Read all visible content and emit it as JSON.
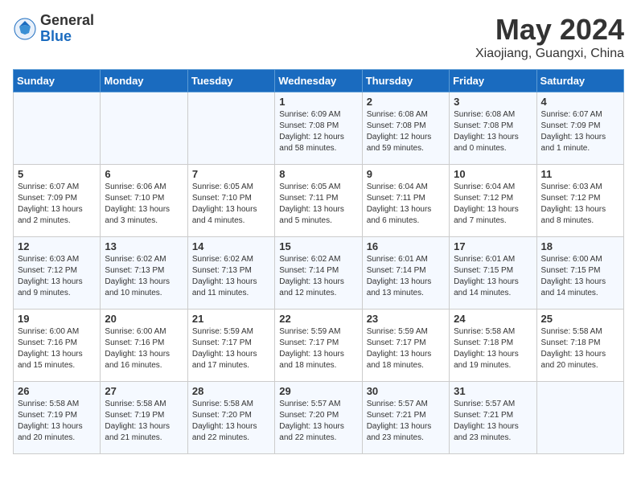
{
  "header": {
    "logo_general": "General",
    "logo_blue": "Blue",
    "month_title": "May 2024",
    "location": "Xiaojiang, Guangxi, China"
  },
  "weekdays": [
    "Sunday",
    "Monday",
    "Tuesday",
    "Wednesday",
    "Thursday",
    "Friday",
    "Saturday"
  ],
  "weeks": [
    [
      {
        "day": "",
        "info": ""
      },
      {
        "day": "",
        "info": ""
      },
      {
        "day": "",
        "info": ""
      },
      {
        "day": "1",
        "info": "Sunrise: 6:09 AM\nSunset: 7:08 PM\nDaylight: 12 hours and 58 minutes."
      },
      {
        "day": "2",
        "info": "Sunrise: 6:08 AM\nSunset: 7:08 PM\nDaylight: 12 hours and 59 minutes."
      },
      {
        "day": "3",
        "info": "Sunrise: 6:08 AM\nSunset: 7:08 PM\nDaylight: 13 hours and 0 minutes."
      },
      {
        "day": "4",
        "info": "Sunrise: 6:07 AM\nSunset: 7:09 PM\nDaylight: 13 hours and 1 minute."
      }
    ],
    [
      {
        "day": "5",
        "info": "Sunrise: 6:07 AM\nSunset: 7:09 PM\nDaylight: 13 hours and 2 minutes."
      },
      {
        "day": "6",
        "info": "Sunrise: 6:06 AM\nSunset: 7:10 PM\nDaylight: 13 hours and 3 minutes."
      },
      {
        "day": "7",
        "info": "Sunrise: 6:05 AM\nSunset: 7:10 PM\nDaylight: 13 hours and 4 minutes."
      },
      {
        "day": "8",
        "info": "Sunrise: 6:05 AM\nSunset: 7:11 PM\nDaylight: 13 hours and 5 minutes."
      },
      {
        "day": "9",
        "info": "Sunrise: 6:04 AM\nSunset: 7:11 PM\nDaylight: 13 hours and 6 minutes."
      },
      {
        "day": "10",
        "info": "Sunrise: 6:04 AM\nSunset: 7:12 PM\nDaylight: 13 hours and 7 minutes."
      },
      {
        "day": "11",
        "info": "Sunrise: 6:03 AM\nSunset: 7:12 PM\nDaylight: 13 hours and 8 minutes."
      }
    ],
    [
      {
        "day": "12",
        "info": "Sunrise: 6:03 AM\nSunset: 7:12 PM\nDaylight: 13 hours and 9 minutes."
      },
      {
        "day": "13",
        "info": "Sunrise: 6:02 AM\nSunset: 7:13 PM\nDaylight: 13 hours and 10 minutes."
      },
      {
        "day": "14",
        "info": "Sunrise: 6:02 AM\nSunset: 7:13 PM\nDaylight: 13 hours and 11 minutes."
      },
      {
        "day": "15",
        "info": "Sunrise: 6:02 AM\nSunset: 7:14 PM\nDaylight: 13 hours and 12 minutes."
      },
      {
        "day": "16",
        "info": "Sunrise: 6:01 AM\nSunset: 7:14 PM\nDaylight: 13 hours and 13 minutes."
      },
      {
        "day": "17",
        "info": "Sunrise: 6:01 AM\nSunset: 7:15 PM\nDaylight: 13 hours and 14 minutes."
      },
      {
        "day": "18",
        "info": "Sunrise: 6:00 AM\nSunset: 7:15 PM\nDaylight: 13 hours and 14 minutes."
      }
    ],
    [
      {
        "day": "19",
        "info": "Sunrise: 6:00 AM\nSunset: 7:16 PM\nDaylight: 13 hours and 15 minutes."
      },
      {
        "day": "20",
        "info": "Sunrise: 6:00 AM\nSunset: 7:16 PM\nDaylight: 13 hours and 16 minutes."
      },
      {
        "day": "21",
        "info": "Sunrise: 5:59 AM\nSunset: 7:17 PM\nDaylight: 13 hours and 17 minutes."
      },
      {
        "day": "22",
        "info": "Sunrise: 5:59 AM\nSunset: 7:17 PM\nDaylight: 13 hours and 18 minutes."
      },
      {
        "day": "23",
        "info": "Sunrise: 5:59 AM\nSunset: 7:17 PM\nDaylight: 13 hours and 18 minutes."
      },
      {
        "day": "24",
        "info": "Sunrise: 5:58 AM\nSunset: 7:18 PM\nDaylight: 13 hours and 19 minutes."
      },
      {
        "day": "25",
        "info": "Sunrise: 5:58 AM\nSunset: 7:18 PM\nDaylight: 13 hours and 20 minutes."
      }
    ],
    [
      {
        "day": "26",
        "info": "Sunrise: 5:58 AM\nSunset: 7:19 PM\nDaylight: 13 hours and 20 minutes."
      },
      {
        "day": "27",
        "info": "Sunrise: 5:58 AM\nSunset: 7:19 PM\nDaylight: 13 hours and 21 minutes."
      },
      {
        "day": "28",
        "info": "Sunrise: 5:58 AM\nSunset: 7:20 PM\nDaylight: 13 hours and 22 minutes."
      },
      {
        "day": "29",
        "info": "Sunrise: 5:57 AM\nSunset: 7:20 PM\nDaylight: 13 hours and 22 minutes."
      },
      {
        "day": "30",
        "info": "Sunrise: 5:57 AM\nSunset: 7:21 PM\nDaylight: 13 hours and 23 minutes."
      },
      {
        "day": "31",
        "info": "Sunrise: 5:57 AM\nSunset: 7:21 PM\nDaylight: 13 hours and 23 minutes."
      },
      {
        "day": "",
        "info": ""
      }
    ]
  ]
}
